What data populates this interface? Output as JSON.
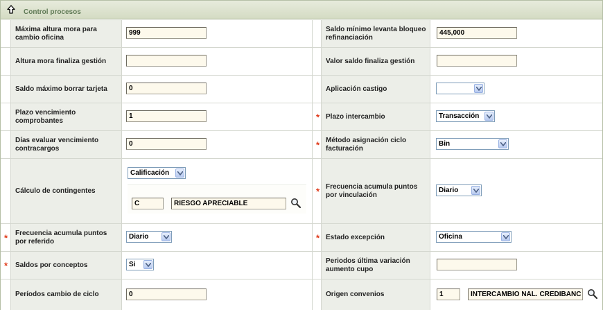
{
  "section": {
    "title": "Control procesos",
    "toggle_icon": "arrow-up-icon"
  },
  "fields": {
    "max_altura_mora": {
      "label": "Máxima altura mora para cambio oficina",
      "value": "999"
    },
    "saldo_min_levanta": {
      "label": "Saldo mínimo levanta bloqueo refinanciación",
      "value": "445,000"
    },
    "altura_mora_finaliza": {
      "label": "Altura mora finaliza gestión",
      "value": ""
    },
    "valor_saldo_finaliza": {
      "label": "Valor saldo finaliza gestión",
      "value": ""
    },
    "saldo_max_borrar": {
      "label": "Saldo máximo borrar tarjeta",
      "value": "0"
    },
    "aplicacion_castigo": {
      "label": "Aplicación castigo",
      "value": ""
    },
    "plazo_vencimiento": {
      "label": "Plazo vencimiento comprobantes",
      "value": "1"
    },
    "plazo_intercambio": {
      "label": "Plazo intercambio",
      "value": "Transacción",
      "required": "*"
    },
    "dias_evaluar": {
      "label": "Días evaluar vencimiento contracargos",
      "value": "0"
    },
    "metodo_asignacion": {
      "label": "Método asignación ciclo facturación",
      "value": "Bin",
      "required": "*"
    },
    "calculo_contingentes": {
      "label": "Cálculo de contingentes",
      "select_value": "Calificación",
      "code": "C",
      "description": "RIESGO APRECIABLE",
      "search_icon": "magnifier-icon"
    },
    "frecuencia_vinculacion": {
      "label": "Frecuencia acumula puntos por vinculación",
      "value": "Diario",
      "required": "*"
    },
    "frecuencia_referido": {
      "label": "Frecuencia acumula puntos por referido",
      "value": "Diario",
      "required": "*"
    },
    "estado_excepcion": {
      "label": "Estado excepción",
      "value": "Oficina",
      "required": "*"
    },
    "saldos_conceptos": {
      "label": "Saldos por conceptos",
      "value": "Si",
      "required": "*"
    },
    "periodos_ultima_variacion": {
      "label": "Periodos última variación aumento cupo",
      "value": ""
    },
    "periodos_cambio_ciclo": {
      "label": "Períodos cambio de ciclo",
      "value": "0"
    },
    "origen_convenios": {
      "label": "Origen convenios",
      "code": "1",
      "description": "INTERCAMBIO NAL. CREDIBANC",
      "search_icon": "magnifier-icon"
    }
  },
  "colors": {
    "label_bg": "#eceee8",
    "input_bg": "#fdf9ec",
    "required": "#e03a1a",
    "header_text": "#5f7a55"
  }
}
